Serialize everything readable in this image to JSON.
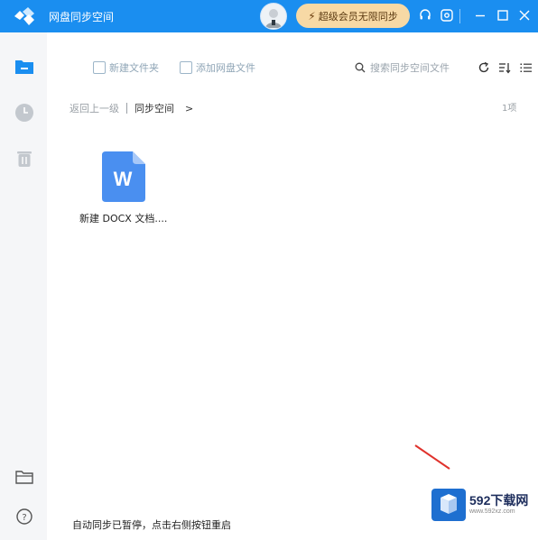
{
  "titlebar": {
    "title": "网盘同步空间",
    "vip_label": "超级会员无限同步",
    "accent": "#1a8ef0"
  },
  "toolbar": {
    "new_folder": "新建文件夹",
    "add_cloud_file": "添加网盘文件",
    "search_placeholder": "搜索同步空间文件"
  },
  "breadcrumb": {
    "back": "返回上一级",
    "current": "同步空间",
    "arrow": ">"
  },
  "item_count": "1项",
  "files": [
    {
      "name": "新建 DOCX 文档....",
      "type": "word",
      "icon_letter": "W"
    }
  ],
  "status": "自动同步已暂停，点击右侧按钮重启",
  "watermark": {
    "text": "592下载网",
    "sub": "www.592xz.com"
  }
}
